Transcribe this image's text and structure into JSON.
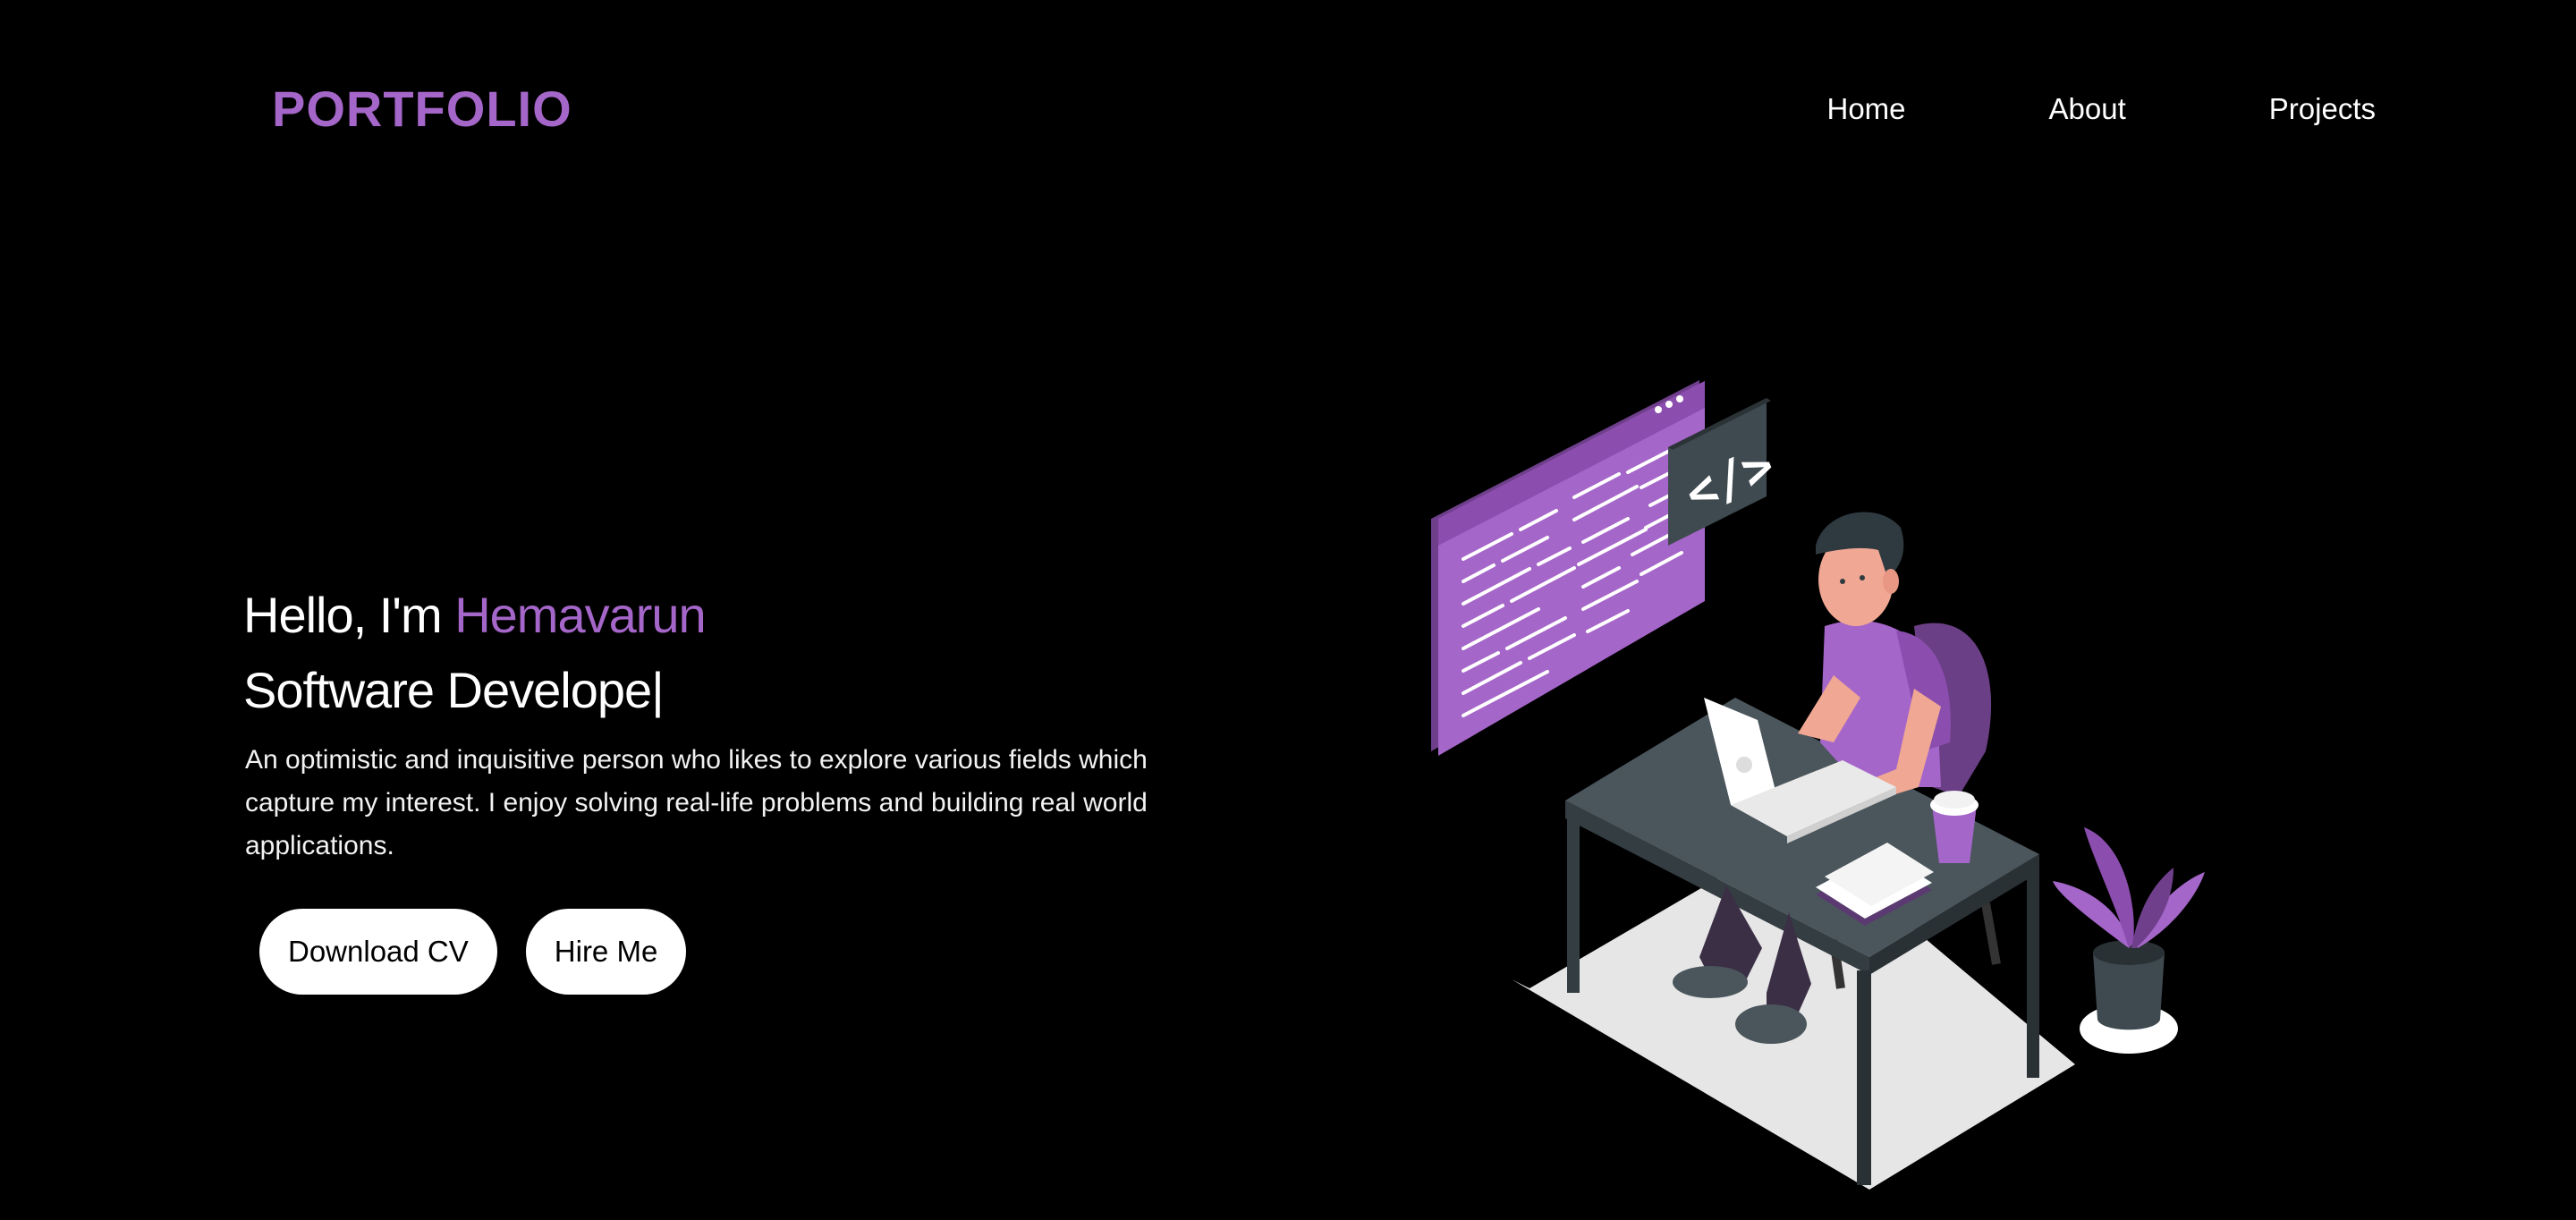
{
  "header": {
    "logo": "PORTFOLIO",
    "nav": [
      {
        "label": "Home"
      },
      {
        "label": "About"
      },
      {
        "label": "Projects"
      }
    ]
  },
  "hero": {
    "greeting_prefix": "Hello, I'm",
    "name": "Hemavarun",
    "role": "Software Develope",
    "cursor": "|",
    "bio": "An optimistic and inquisitive person who likes to explore various fields which capture my interest. I enjoy solving real-life problems and building real world applications.",
    "buttons": {
      "download": "Download CV",
      "hire": "Hire Me"
    }
  },
  "illustration": {
    "code_icon": "</>",
    "description_icon": "developer-at-desk-illustration"
  },
  "colors": {
    "background": "#000000",
    "accent": "#a566c9",
    "text": "#ffffff"
  }
}
